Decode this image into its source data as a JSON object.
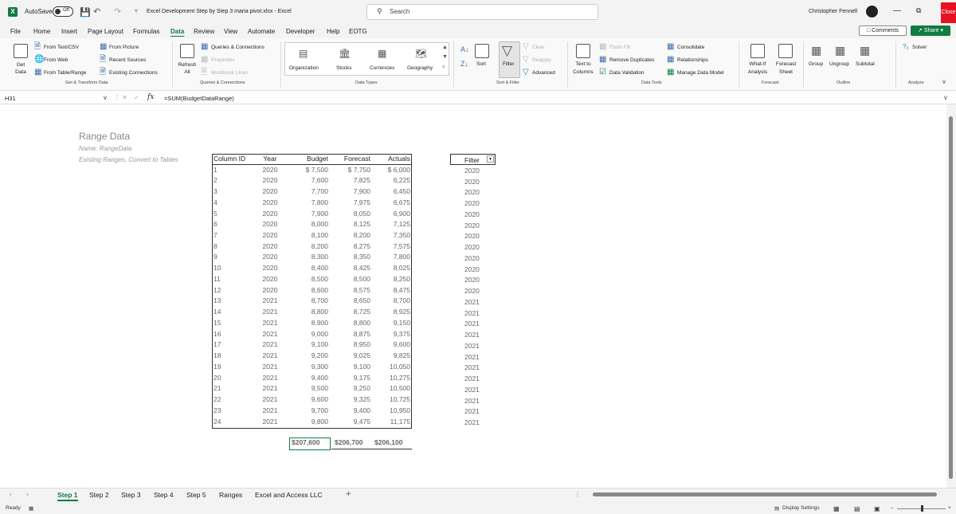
{
  "titlebar": {
    "autosave_label": "AutoSave",
    "autosave_state": "Off",
    "filename": "Excel Development Step by Step 3  maria pivot.xlsx  -  Excel",
    "search_placeholder": "Search",
    "user_name": "Christopher Fennell",
    "close_label": "Close"
  },
  "menu": [
    "File",
    "Home",
    "Insert",
    "Page Layout",
    "Formulas",
    "Data",
    "Review",
    "View",
    "Automate",
    "Developer",
    "Help",
    "EOTG"
  ],
  "menu_active": "Data",
  "comments_label": "Comments",
  "share_label": "Share",
  "ribbon": {
    "get_data": "Get Data",
    "from_text_csv": "From Text/CSV",
    "from_web": "From Web",
    "from_table_range": "From Table/Range",
    "from_picture": "From Picture",
    "recent_sources": "Recent Sources",
    "existing_connections": "Existing Connections",
    "group_get_transform": "Get & Transform Data",
    "refresh_all": "Refresh All",
    "queries_connections": "Queries & Connections",
    "properties": "Properties",
    "workbook_links": "Workbook Links",
    "group_queries": "Queries & Connections",
    "data_types": [
      "Organization",
      "Stocks",
      "Currencies",
      "Geography"
    ],
    "group_data_types": "Data Types",
    "sort": "Sort",
    "filter": "Filter",
    "clear": "Clear",
    "reapply": "Reapply",
    "advanced": "Advanced",
    "group_sort_filter": "Sort & Filter",
    "text_to_columns": "Text to Columns",
    "flash_fill": "Flash Fill",
    "remove_duplicates": "Remove Duplicates",
    "data_validation": "Data Validation",
    "consolidate": "Consolidate",
    "relationships": "Relationships",
    "manage_data_model": "Manage Data Model",
    "group_data_tools": "Data Tools",
    "what_if": "What-If Analysis",
    "forecast_sheet": "Forecast Sheet",
    "group_forecast": "Forecast",
    "group": "Group",
    "ungroup": "Ungroup",
    "subtotal": "Subtotal",
    "group_outline": "Outline",
    "solver": "Solver",
    "group_analyze": "Analyze"
  },
  "formula_bar": {
    "name_box": "H31",
    "formula": "=SUM(BudgetDataRange)"
  },
  "sheet": {
    "title": "Range Data",
    "name_line": "Name:  RangeData",
    "existing_line": "Existing Ranges, Convert to Tables",
    "headers": [
      "Column ID",
      "Year",
      "Budget",
      "Forecast",
      "Actuals"
    ],
    "rows": [
      [
        "1",
        "2020",
        "$    7,500",
        "$    7,750",
        "$    6,000"
      ],
      [
        "2",
        "2020",
        "7,600",
        "7,825",
        "6,225"
      ],
      [
        "3",
        "2020",
        "7,700",
        "7,900",
        "6,450"
      ],
      [
        "4",
        "2020",
        "7,800",
        "7,975",
        "6,675"
      ],
      [
        "5",
        "2020",
        "7,900",
        "8,050",
        "6,900"
      ],
      [
        "6",
        "2020",
        "8,000",
        "8,125",
        "7,125"
      ],
      [
        "7",
        "2020",
        "8,100",
        "8,200",
        "7,350"
      ],
      [
        "8",
        "2020",
        "8,200",
        "8,275",
        "7,575"
      ],
      [
        "9",
        "2020",
        "8,300",
        "8,350",
        "7,800"
      ],
      [
        "10",
        "2020",
        "8,400",
        "8,425",
        "8,025"
      ],
      [
        "11",
        "2020",
        "8,500",
        "8,500",
        "8,250"
      ],
      [
        "12",
        "2020",
        "8,600",
        "8,575",
        "8,475"
      ],
      [
        "13",
        "2021",
        "8,700",
        "8,650",
        "8,700"
      ],
      [
        "14",
        "2021",
        "8,800",
        "8,725",
        "8,925"
      ],
      [
        "15",
        "2021",
        "8,900",
        "8,800",
        "9,150"
      ],
      [
        "16",
        "2021",
        "9,000",
        "8,875",
        "9,375"
      ],
      [
        "17",
        "2021",
        "9,100",
        "8,950",
        "9,600"
      ],
      [
        "18",
        "2021",
        "9,200",
        "9,025",
        "9,825"
      ],
      [
        "19",
        "2021",
        "9,300",
        "9,100",
        "10,050"
      ],
      [
        "20",
        "2021",
        "9,400",
        "9,175",
        "10,275"
      ],
      [
        "21",
        "2021",
        "9,500",
        "9,250",
        "10,500"
      ],
      [
        "22",
        "2021",
        "9,600",
        "9,325",
        "10,725"
      ],
      [
        "23",
        "2021",
        "9,700",
        "9,400",
        "10,950"
      ],
      [
        "24",
        "2021",
        "9,800",
        "9,475",
        "11,175"
      ]
    ],
    "totals": [
      "$207,600",
      "$206,700",
      "$206,100"
    ],
    "filter_header": "Filter",
    "filter_values": [
      "2020",
      "2020",
      "2020",
      "2020",
      "2020",
      "2020",
      "2020",
      "2020",
      "2020",
      "2020",
      "2020",
      "2020",
      "2021",
      "2021",
      "2021",
      "2021",
      "2021",
      "2021",
      "2021",
      "2021",
      "2021",
      "2021",
      "2021",
      "2021"
    ]
  },
  "tabs": [
    "Step 1",
    "Step 2",
    "Step 3",
    "Step 4",
    "Step 5",
    "Ranges",
    "Excel and Access LLC"
  ],
  "tab_active": "Step 1",
  "status": {
    "ready": "Ready",
    "display_settings": "Display Settings"
  },
  "colors": {
    "excel_green": "#107c41",
    "close_red": "#e81123"
  }
}
